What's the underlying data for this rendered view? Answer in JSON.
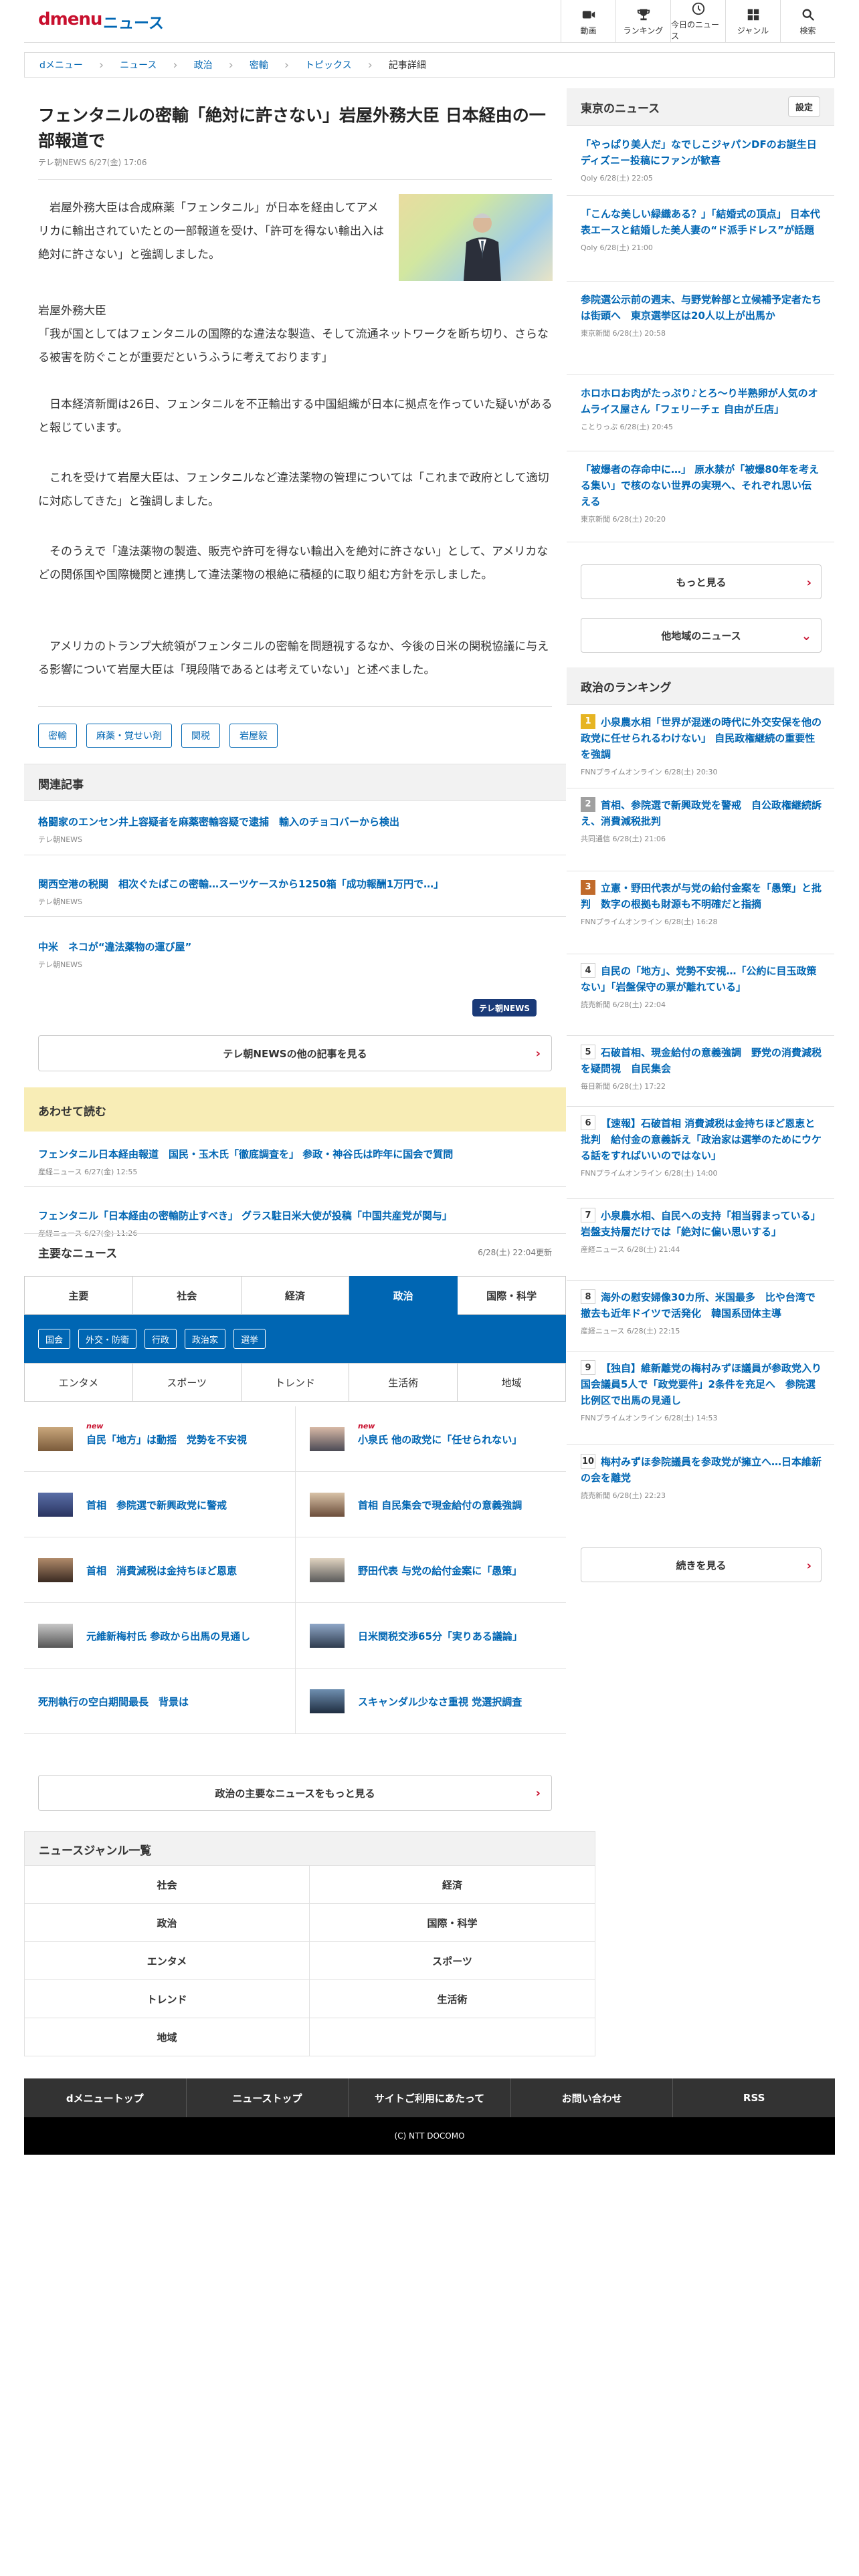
{
  "header": {
    "logo": "dmenu",
    "service": "ニュース",
    "nav": [
      {
        "label": "動画",
        "icon": "video-icon"
      },
      {
        "label": "ランキング",
        "icon": "trophy-icon"
      },
      {
        "label": "今日のニュース",
        "icon": "clock-icon"
      },
      {
        "label": "ジャンル",
        "icon": "grid-icon"
      },
      {
        "label": "検索",
        "icon": "search-icon"
      }
    ]
  },
  "breadcrumb": [
    "dメニュー",
    "ニュース",
    "政治",
    "密輸",
    "トピックス",
    "記事詳細"
  ],
  "article": {
    "title": "フェンタニルの密輸「絶対に許さない」岩屋外務大臣 日本経由の一部報道で",
    "meta": "テレ朝NEWS 6/27(金) 17:06",
    "paragraphs": [
      "　岩屋外務大臣は合成麻薬「フェンタニル」が日本を経由してアメリカに輸出されていたとの一部報道を受け、「許可を得ない輸出入は絶対に許さない」と強調しました。",
      "岩屋外務大臣",
      "「我が国としてはフェンタニルの国際的な違法な製造、そして流通ネットワークを断ち切り、さらなる被害を防ぐことが重要だというふうに考えております」",
      "　日本経済新聞は26日、フェンタニルを不正輸出する中国組織が日本に拠点を作っていた疑いがあると報じています。",
      "　これを受けて岩屋大臣は、フェンタニルなど違法薬物の管理については「これまで政府として適切に対応してきた」と強調しました。",
      "　そのうえで「違法薬物の製造、販売や許可を得ない輸出入を絶対に許さない」として、アメリカなどの関係国や国際機関と連携して違法薬物の根絶に積極的に取り組む方針を示しました。",
      "　アメリカのトランプ大統領がフェンタニルの密輸を問題視するなか、今後の日米の関税協議に与える影響について岩屋大臣は「現段階であるとは考えていない」と述べました。"
    ],
    "tags": [
      "密輸",
      "麻薬・覚せい剤",
      "関税",
      "岩屋毅"
    ]
  },
  "related": {
    "heading": "関連記事",
    "items": [
      {
        "title": "格闘家のエンセン井上容疑者を麻薬密輸容疑で逮捕　輸入のチョコバーから検出",
        "source": "テレ朝NEWS"
      },
      {
        "title": "関西空港の税関　相次ぐたばこの密輸…スーツケースから1250箱「成功報酬1万円で…」",
        "source": "テレ朝NEWS"
      },
      {
        "title": "中米　ネコが“違法薬物の運び屋”",
        "source": "テレ朝NEWS"
      }
    ],
    "logo": "テレ朝NEWS",
    "more": "テレ朝NEWSの他の記事を見る"
  },
  "also_read": {
    "heading": "あわせて読む",
    "items": [
      {
        "title": "フェンタニル日本経由報道　国民・玉木氏「徹底調査を」 参政・神谷氏は昨年に国会で質問",
        "source": "産経ニュース 6/27(金) 12:55"
      },
      {
        "title": "フェンタニル「日本経由の密輸防止すべき」 グラス駐日米大使が投稿「中国共産党が関与」",
        "source": "産経ニュース 6/27(金) 11:26"
      }
    ]
  },
  "main_news": {
    "heading": "主要なニュース",
    "updated": "6/28(土) 22:04更新",
    "tabs": [
      "主要",
      "社会",
      "経済",
      "政治",
      "国際・科学"
    ],
    "subtags": [
      "国会",
      "外交・防衛",
      "行政",
      "政治家",
      "選挙"
    ],
    "tabs2": [
      "エンタメ",
      "スポーツ",
      "トレンド",
      "生活術",
      "地域"
    ],
    "new_label": "new",
    "items": [
      {
        "title": "自民「地方」は動揺　党勢を不安視",
        "new": true
      },
      {
        "title": "小泉氏 他の政党に「任せられない」",
        "new": true
      },
      {
        "title": "首相　参院選で新興政党に警戒",
        "new": false
      },
      {
        "title": "首相 自民集会で現金給付の意義強調",
        "new": false
      },
      {
        "title": "首相　消費減税は金持ちほど恩恵",
        "new": false
      },
      {
        "title": "野田代表 与党の給付金案に「愚策」",
        "new": false
      },
      {
        "title": "元維新梅村氏 参政から出馬の見通し",
        "new": false
      },
      {
        "title": "日米関税交渉65分「実りある議論」",
        "new": false
      },
      {
        "title": "死刑執行の空白期間最長　背景は",
        "new": false
      },
      {
        "title": "スキャンダル少なさ重視 党選択調査",
        "new": false
      }
    ],
    "more": "政治の主要なニュースをもっと見る"
  },
  "sidebar": {
    "tokyo": {
      "heading": "東京のニュース",
      "setting": "設定",
      "items": [
        {
          "title": "「やっぱり美人だ」なでしこジャパンDFのお誕生日ディズニー投稿にファンが歓喜",
          "source": "Qoly 6/28(土) 22:05"
        },
        {
          "title": "「こんな美しい緑織ある？」「結婚式の頂点」 日本代表エースと結婚した美人妻の“ド派手ドレス”が話題",
          "source": "Qoly 6/28(土) 21:00"
        },
        {
          "title": "参院選公示前の週末、与野党幹部と立候補予定者たちは街頭へ　東京選挙区は20人以上が出馬か",
          "source": "東京新聞 6/28(土) 20:58"
        },
        {
          "title": "ホロホロお肉がたっぷり♪とろ～り半熟卵が人気のオムライス屋さん「フェリーチェ 自由が丘店」",
          "source": "ことりっぷ 6/28(土) 20:45"
        },
        {
          "title": "「被爆者の存命中に…」 原水禁が「被爆80年を考える集い」で核のない世界の実現へ、それぞれ思い伝える",
          "source": "東京新聞 6/28(土) 20:20"
        }
      ],
      "more": "もっと見る",
      "other": "他地域のニュース"
    },
    "ranking": {
      "heading": "政治のランキング",
      "items": [
        {
          "title": "小泉農水相「世界が混迷の時代に外交安保を他の政党に任せられるわけない」 自民政権継続の重要性を強調",
          "source": "FNNプライムオンライン 6/28(土) 20:30",
          "color": "#e6b422"
        },
        {
          "title": "首相、参院選で新興政党を警戒　自公政権継続訴え、消費減税批判",
          "source": "共同通信 6/28(土) 21:06",
          "color": "#a0a0a0"
        },
        {
          "title": "立憲・野田代表が与党の給付金案を「愚策」と批判　数字の根拠も財源も不明確だと指摘",
          "source": "FNNプライムオンライン 6/28(土) 16:28",
          "color": "#c06a2b"
        },
        {
          "title": "自民の「地方」、党勢不安視…「公約に目玉政策ない」「岩盤保守の票が離れている」",
          "source": "読売新聞 6/28(土) 22:04",
          "color": "#ffffff"
        },
        {
          "title": "石破首相、現金給付の意義強調　野党の消費減税を疑問視　自民集会",
          "source": "毎日新聞 6/28(土) 17:22",
          "color": "#ffffff"
        },
        {
          "title": "【速報】石破首相 消費減税は金持ちほど恩恵と批判　給付金の意義訴え「政治家は選挙のためにウケる話をすればいいのではない」",
          "source": "FNNプライムオンライン 6/28(土) 14:00",
          "color": "#ffffff"
        },
        {
          "title": "小泉農水相、自民への支持「相当弱まっている」岩盤支持層だけでは「絶対に偏い思いする」",
          "source": "産経ニュース 6/28(土) 21:44",
          "color": "#ffffff"
        },
        {
          "title": "海外の慰安婦像30カ所、米国最多　比や台湾で撤去も近年ドイツで活発化　韓国系団体主導",
          "source": "産経ニュース 6/28(土) 22:15",
          "color": "#ffffff"
        },
        {
          "title": "【独自】維新離党の梅村みずほ議員が参政党入り　国会議員5人で「政党要件」2条件を充足へ　参院選比例区で出馬の見通し",
          "source": "FNNプライムオンライン 6/28(土) 14:53",
          "color": "#ffffff"
        },
        {
          "title": "梅村みずほ参院議員を参政党が擁立へ…日本維新の会を離党",
          "source": "読売新聞 6/28(土) 22:23",
          "color": "#ffffff"
        }
      ],
      "more": "続きを見る"
    }
  },
  "genre": {
    "heading": "ニュースジャンル一覧",
    "items": [
      "社会",
      "経済",
      "政治",
      "国際・科学",
      "エンタメ",
      "スポーツ",
      "トレンド",
      "生活術",
      "地域",
      ""
    ]
  },
  "footer": {
    "nav": [
      "dメニュートップ",
      "ニューストップ",
      "サイトご利用にあたって",
      "お問い合わせ",
      "RSS"
    ],
    "copyright": "(C) NTT DOCOMO"
  },
  "colors": {
    "brand_red": "#c8102e",
    "link_blue": "#0066b3",
    "active_tab": "#0066b3"
  }
}
